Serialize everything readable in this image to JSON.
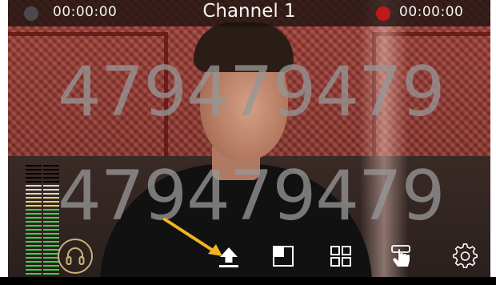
{
  "topbar": {
    "left_timecode": "00:00:00",
    "channel_title": "Channel 1",
    "right_timecode": "00:00:00",
    "record_indicator_color": "#c01818",
    "idle_indicator_color": "#4a4a4a"
  },
  "overlay": {
    "top_number": "479479479",
    "bottom_number": "479479479"
  },
  "audio_meter": {
    "left_level": 0.82,
    "right_level": 0.82
  },
  "toolbar": {
    "buttons": [
      {
        "name": "headphones",
        "icon": "headphones-icon"
      },
      {
        "name": "upload",
        "icon": "upload-icon"
      },
      {
        "name": "single-view",
        "icon": "single-view-icon"
      },
      {
        "name": "grid-view",
        "icon": "grid-view-icon"
      },
      {
        "name": "touch",
        "icon": "touch-icon"
      },
      {
        "name": "settings",
        "icon": "gear-icon"
      }
    ]
  },
  "annotation": {
    "arrow_color": "#f0b420",
    "target": "upload-button"
  }
}
